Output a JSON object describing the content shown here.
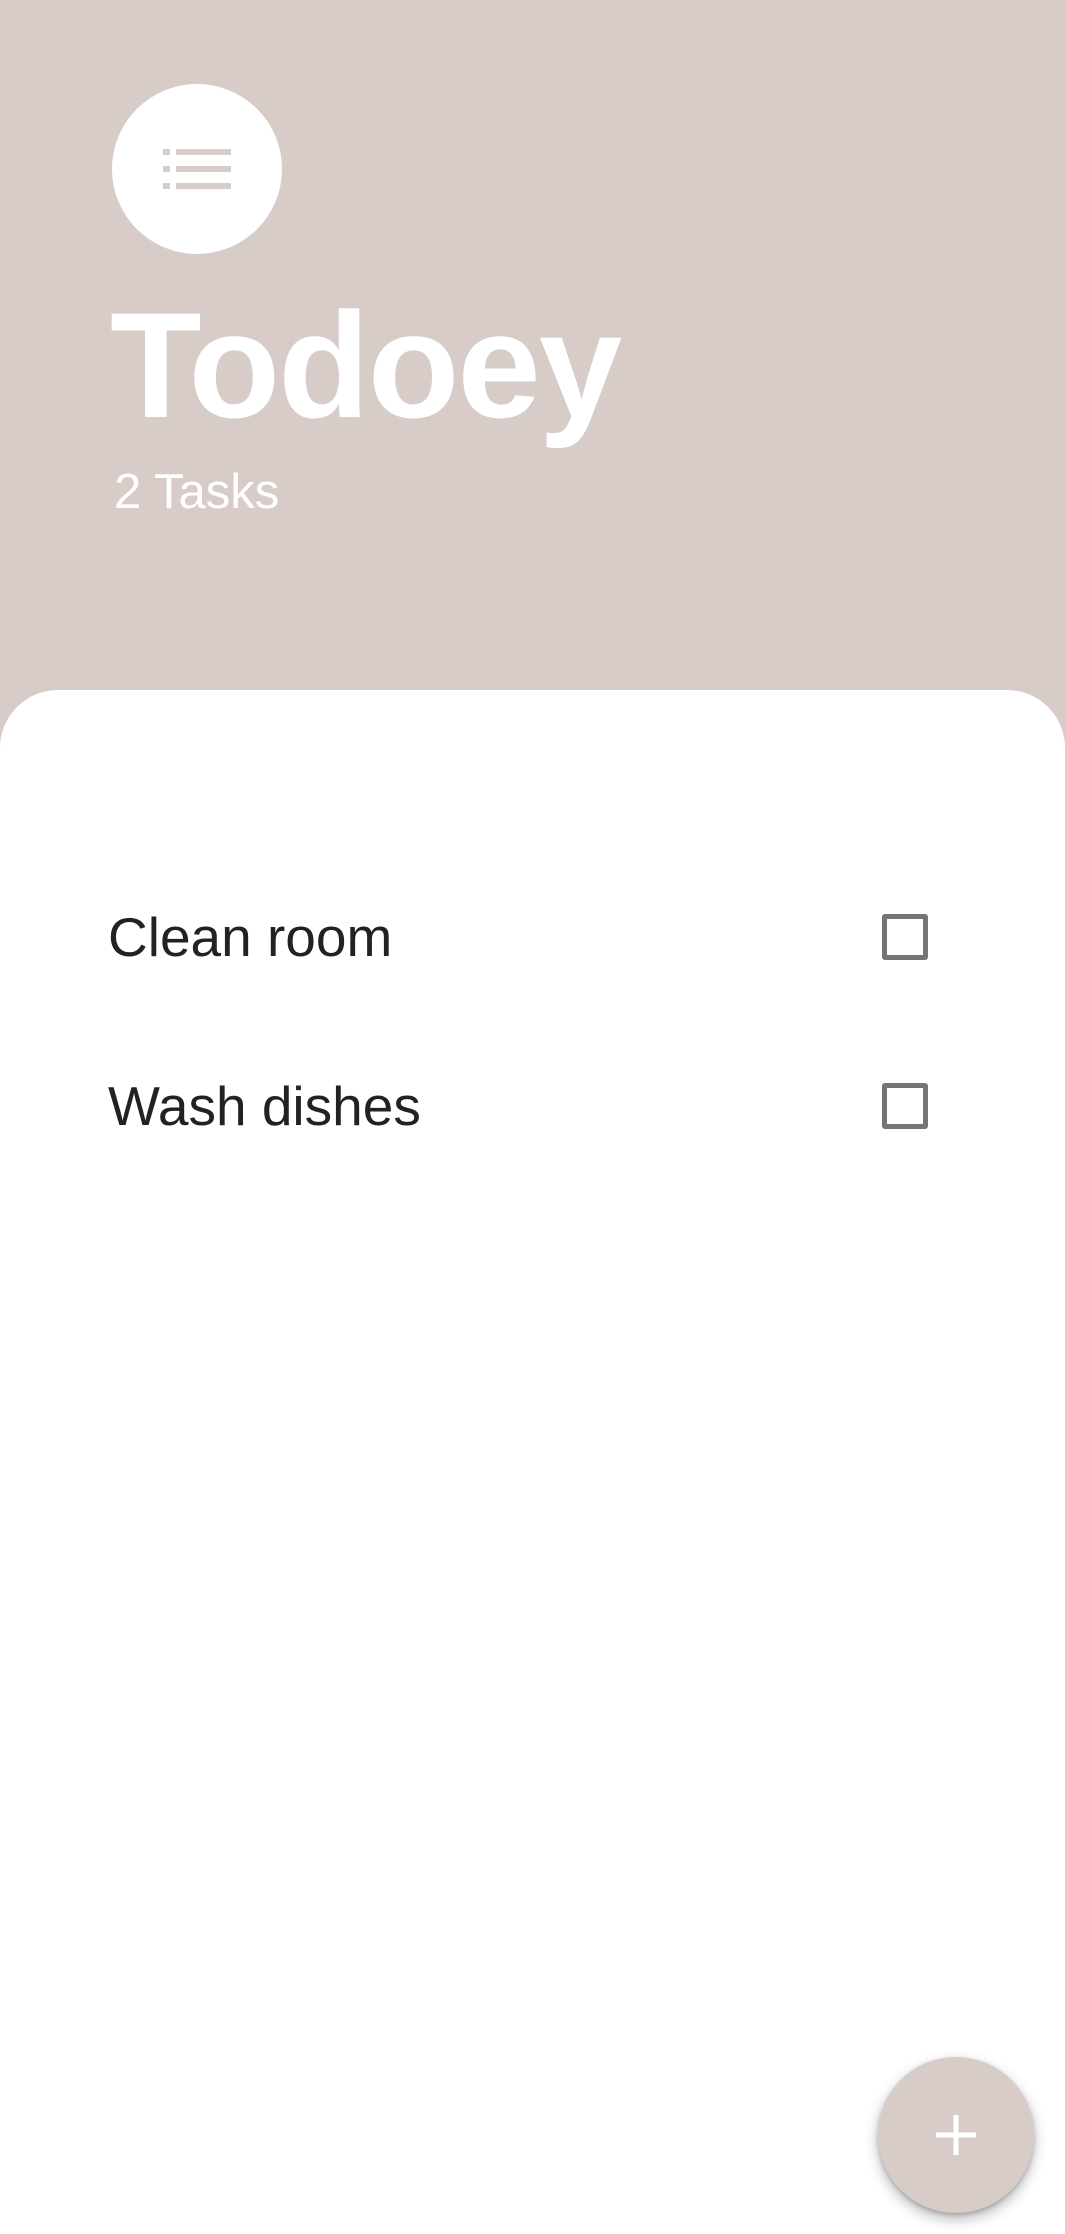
{
  "colors": {
    "accent": "#d8ccc9",
    "sheet_background": "#ffffff",
    "task_text": "#222222",
    "checkbox_border": "#757575"
  },
  "header": {
    "menu_icon": "list-icon",
    "title": "Todoey",
    "task_count": "2 Tasks"
  },
  "tasks": [
    {
      "label": "Clean room",
      "checked": false
    },
    {
      "label": "Wash dishes",
      "checked": false
    }
  ],
  "fab": {
    "icon": "plus-icon"
  }
}
